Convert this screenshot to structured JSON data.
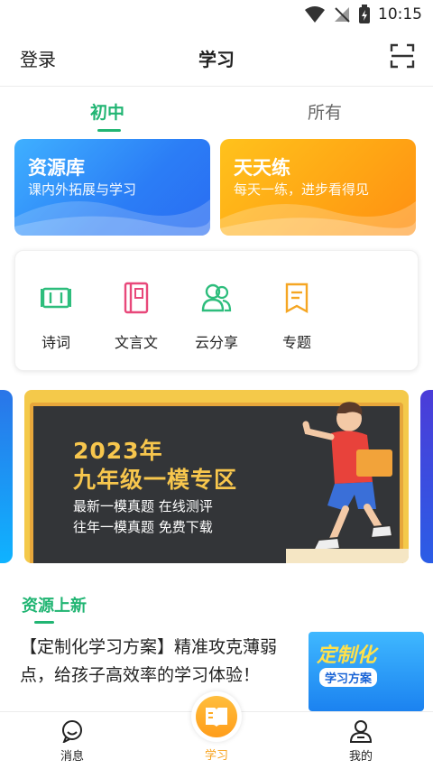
{
  "status_bar": {
    "time": "10:15"
  },
  "header": {
    "login_label": "登录",
    "title": "学习"
  },
  "tabs": [
    {
      "label": "初中",
      "active": true
    },
    {
      "label": "所有",
      "active": false
    }
  ],
  "cards": [
    {
      "title": "资源库",
      "subtitle": "课内外拓展与学习"
    },
    {
      "title": "天天练",
      "subtitle": "每天一练，进步看得见"
    }
  ],
  "functions": [
    {
      "label": "诗词",
      "icon": "poem-icon"
    },
    {
      "label": "文言文",
      "icon": "book-icon"
    },
    {
      "label": "云分享",
      "icon": "users-icon"
    },
    {
      "label": "专题",
      "icon": "topic-icon"
    }
  ],
  "banner": {
    "year": "2023年",
    "title": "九年级一模专区",
    "line1": "最新一模真题 在线测评",
    "line2": "往年一模真题 免费下载"
  },
  "section": {
    "title": "资源上新"
  },
  "article": {
    "text": "【定制化学习方案】精准攻克薄弱点，给孩子高效率的学习体验！",
    "thumb_title": "定制化",
    "thumb_subtitle": "学习方案"
  },
  "bottom_nav": [
    {
      "label": "消息",
      "icon": "message-icon"
    },
    {
      "label": "学习",
      "icon": "study-book-icon",
      "active": true
    },
    {
      "label": "我的",
      "icon": "profile-icon"
    }
  ],
  "colors": {
    "accent": "#21b573",
    "card_blue": "#2b7df6",
    "card_orange": "#ffa414",
    "nav_active": "#f7a21b"
  }
}
